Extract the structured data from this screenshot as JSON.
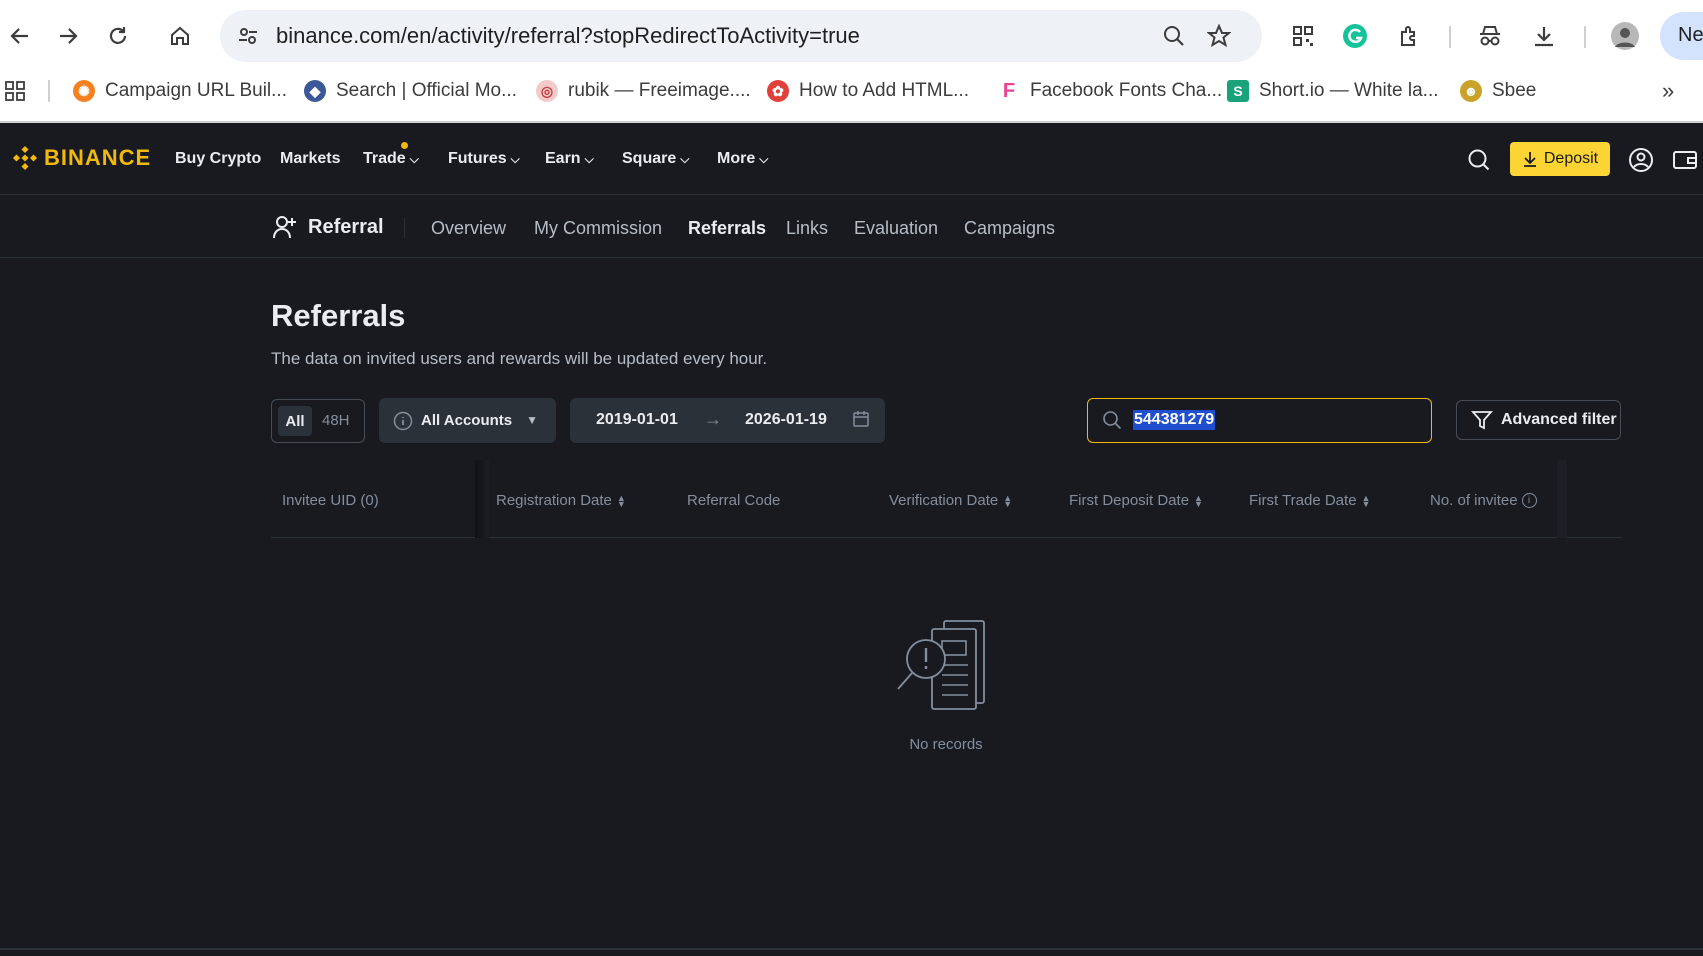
{
  "browser": {
    "url": "binance.com/en/activity/referral?stopRedirectToActivity=true",
    "new_tab_label": "Nev",
    "bookmarks": [
      {
        "label": "Campaign URL Buil...",
        "color": "#f4811f"
      },
      {
        "label": "Search | Official Mo...",
        "color": "#3b5998"
      },
      {
        "label": "rubik — Freeimage....",
        "color": "#e8a0a0"
      },
      {
        "label": "How to Add HTML...",
        "color": "#e0413b"
      },
      {
        "label": "Facebook Fonts Cha...",
        "color": "#e84393"
      },
      {
        "label": "Short.io — White la...",
        "color": "#1aa37a"
      },
      {
        "label": "Sbee",
        "color": "#c9a227"
      }
    ]
  },
  "header": {
    "logo": "BINANCE",
    "nav": [
      {
        "label": "Buy Crypto"
      },
      {
        "label": "Markets"
      },
      {
        "label": "Trade"
      },
      {
        "label": "Futures"
      },
      {
        "label": "Earn"
      },
      {
        "label": "Square"
      },
      {
        "label": "More"
      }
    ],
    "deposit_label": "Deposit"
  },
  "subnav": {
    "title": "Referral",
    "items": [
      {
        "label": "Overview"
      },
      {
        "label": "My Commission"
      },
      {
        "label": "Referrals"
      },
      {
        "label": "Links"
      },
      {
        "label": "Evaluation"
      },
      {
        "label": "Campaigns"
      }
    ],
    "active": "Referrals"
  },
  "main": {
    "title": "Referrals",
    "description": "The data on invited users and rewards will be updated every hour.",
    "filters": {
      "all_label": "All",
      "h48_label": "48H",
      "accounts_label": "All Accounts",
      "date_from": "2019-01-01",
      "date_to": "2026-01-19",
      "search_value": "544381279",
      "advanced_label": "Advanced filter"
    },
    "table": {
      "columns": [
        "Invitee UID (0)",
        "Registration Date",
        "Referral Code",
        "Verification Date",
        "First Deposit Date",
        "First Trade Date",
        "No. of invitee"
      ]
    },
    "empty_text": "No records"
  },
  "colors": {
    "background": "#181a20",
    "accent": "#f0b90b",
    "deposit": "#fcd535",
    "text_primary": "#eaecef",
    "text_secondary": "#848e9c"
  }
}
